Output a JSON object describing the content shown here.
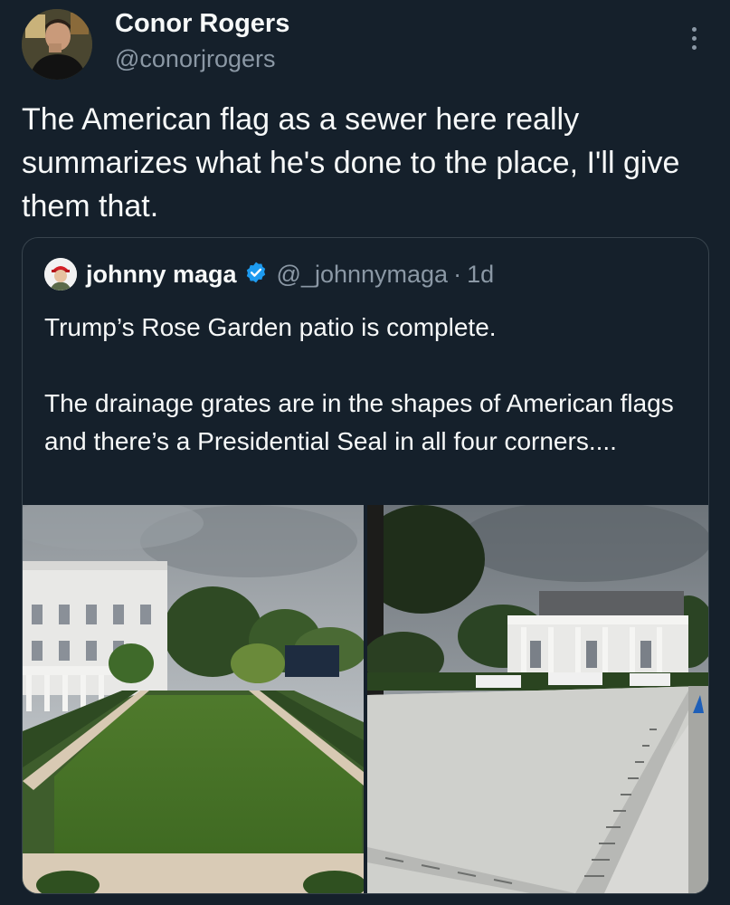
{
  "tweet": {
    "author_name": "Conor Rogers",
    "author_handle": "@conorjrogers",
    "text": "The American flag as a sewer here really summarizes what he's done to the place, I'll give them that."
  },
  "quoted_tweet": {
    "author_name": "johnny maga",
    "author_handle": "@_johnnymaga",
    "separator": "·",
    "time": "1d",
    "text": "Trump’s Rose Garden patio is complete.\n\nThe drainage grates are in the shapes of American flags and there’s a Presidential Seal in all four corners....",
    "verified": true,
    "verified_color": "#1d9bf0"
  },
  "icons": {
    "more": "more-options-icon",
    "verified": "verified-badge-icon"
  }
}
